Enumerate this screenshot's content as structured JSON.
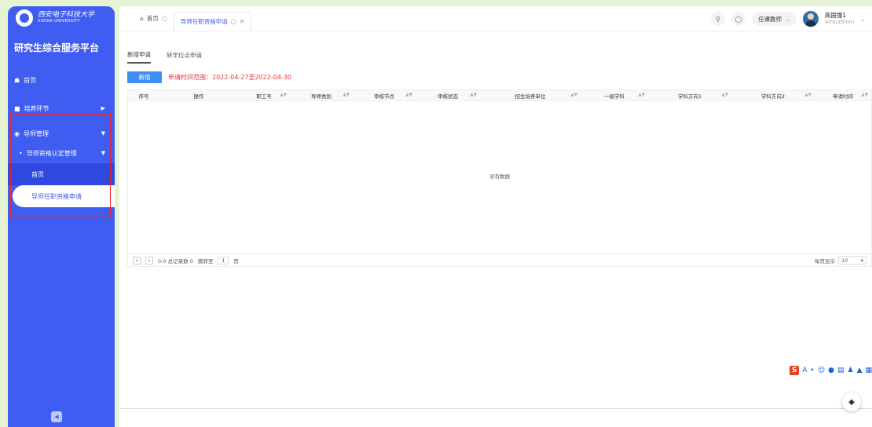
{
  "sidebar": {
    "logo_cn": "西安电子科技大学",
    "logo_en": "XIDIAN UNIVERSITY",
    "system_title": "研究生综合服务平台",
    "menu": [
      {
        "label": "首页"
      },
      {
        "label": "培养环节"
      },
      {
        "label": "导师管理"
      }
    ],
    "submenu_label": "导师资格认定管理",
    "leaf_home": "首页",
    "leaf_active": "导师任职资格申请"
  },
  "topbar": {
    "home_tab": "首页",
    "current_tab": "导师任职资格申请",
    "role": "任课教师",
    "user_name": "高国强1",
    "user_account": "ampadmin"
  },
  "content": {
    "subtabs": [
      "新增申请",
      "转学位点申请"
    ],
    "new_button": "新增",
    "range_note": "申请时间范围：2022-04-27至2022-04-30",
    "columns": [
      "序号",
      "操作",
      "职工号",
      "导师类别",
      "审核节点",
      "审核状态",
      "招生培养单位",
      "一级学科",
      "学科方向1",
      "学科方向2",
      "申请时间"
    ],
    "no_data": "没有数据",
    "pager": {
      "summary": "0-0 总记录数 0",
      "jump_label": "跳转至",
      "page": "1",
      "page_unit": "页",
      "per_page_label": "每页显示",
      "per_page": "10"
    }
  },
  "ime": {
    "icons": [
      "sogou-s-icon",
      "a-icon",
      "comma-icon",
      "emoji-icon",
      "mic-icon",
      "keyboard-icon",
      "person-icon",
      "shirt-icon",
      "grid-icon"
    ]
  },
  "colors": {
    "sidebar_blue": "#3f5df0",
    "accent_red": "#e22222",
    "button_blue": "#3f8ef7",
    "background_green": "#e6f4d6"
  }
}
